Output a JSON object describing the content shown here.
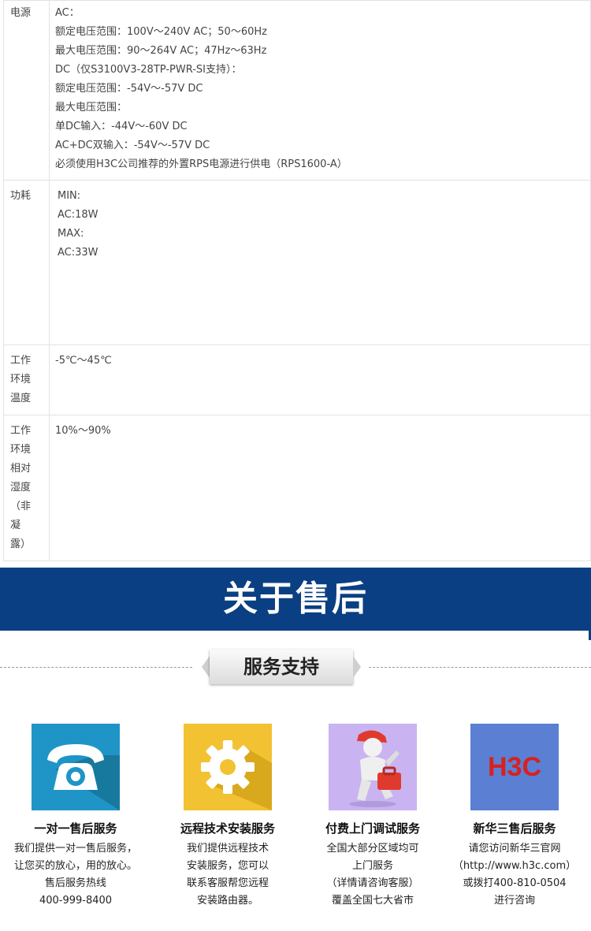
{
  "specs": [
    {
      "label_lines": [
        "电源"
      ],
      "value_lines": [
        "AC：",
        "额定电压范围：100V～240V AC；50～60Hz",
        "最大电压范围：90～264V AC；47Hz～63Hz",
        "DC（仅S3100V3-28TP-PWR-SI支持）：",
        "额定电压范围：-54V～-57V DC",
        "最大电压范围：",
        "单DC输入：-44V～-60V DC",
        "AC+DC双输入：-54V～-57V DC",
        "必须使用H3C公司推荐的外置RPS电源进行供电（RPS1600-A）"
      ]
    },
    {
      "label_lines": [
        "功耗"
      ],
      "value_lines": [
        "MIN:",
        "AC:18W",
        "MAX:",
        "AC:33W"
      ]
    },
    {
      "label_lines": [
        "工作",
        "环境",
        "温度"
      ],
      "value_lines": [
        "-5℃～45℃"
      ]
    },
    {
      "label_lines": [
        "工作",
        "环境",
        "相对",
        "湿度",
        "（非",
        "凝",
        "露）"
      ],
      "value_lines": [
        "10%～90%"
      ]
    }
  ],
  "banner": {
    "title": "关于售后",
    "color": "#0b3f83"
  },
  "section": {
    "title": "服务支持"
  },
  "cards": [
    {
      "icon": "telephone-icon",
      "color": "#1f95c7",
      "title": "一对一售后服务",
      "lines": [
        "我们提供一对一售后服务，",
        "让您买的放心，用的放心。",
        "售后服务热线",
        "400-999-8400"
      ]
    },
    {
      "icon": "gear-icon",
      "color": "#f3c233",
      "title": "远程技术安装服务",
      "lines": [
        "我们提供远程技术",
        "安装服务，您可以",
        "联系客服帮您远程",
        "安装路由器。"
      ]
    },
    {
      "icon": "repairman-icon",
      "color": "#c9b3f0",
      "title": "付费上门调试服务",
      "lines": [
        "全国大部分区域均可",
        "上门服务",
        "（详情请咨询客服）",
        "覆盖全国七大省市"
      ]
    },
    {
      "icon": "h3c-logo-icon",
      "logo_text": "H3C",
      "color": "#5a7fd3",
      "title": "新华三售后服务",
      "lines": [
        "请您访问新华三官网",
        "（http://www.h3c.com）",
        "或拨打400-810-0504",
        "进行咨询"
      ]
    }
  ]
}
